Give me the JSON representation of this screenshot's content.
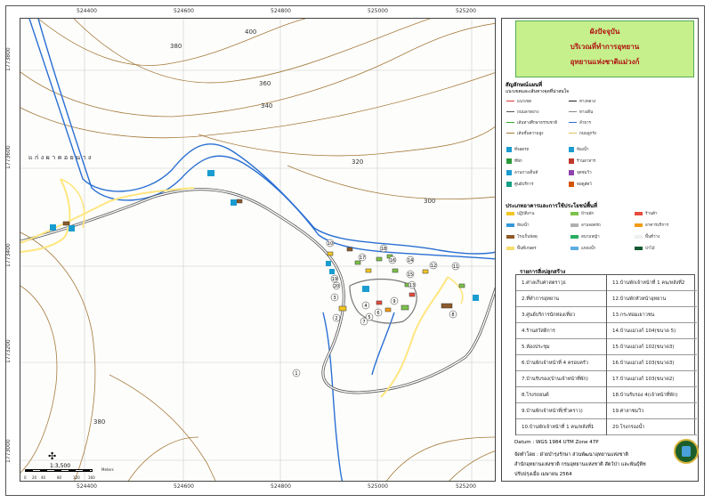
{
  "map": {
    "place_label": "แก่งผาคอยนาง",
    "contours": [
      "400",
      "380",
      "360",
      "340",
      "320",
      "300",
      "380"
    ],
    "x_ticks": [
      "524400",
      "524600",
      "524800",
      "525000",
      "525200"
    ],
    "y_ticks": [
      "1773800",
      "1773600",
      "1773400",
      "1773200",
      "1773000"
    ],
    "building_numbers": [
      "1",
      "2",
      "3",
      "4",
      "5",
      "6",
      "7",
      "8",
      "9",
      "10",
      "11",
      "12",
      "13",
      "14",
      "15",
      "16",
      "17",
      "18",
      "19",
      "20"
    ],
    "scale_text": "1:3,500",
    "scale_unit": "Meters",
    "scale_marks": [
      "0",
      "20",
      "40",
      "80",
      "120",
      "160"
    ],
    "colors": {
      "stream": "#2a6fd4",
      "road": "#ffe680",
      "contour": "#a57a3c",
      "title_bg": "#c6f08c"
    }
  },
  "title": {
    "line1": "ผังปัจจุบัน",
    "line2": "บริเวณที่ทำการอุทยาน",
    "line3": "อุทยานแห่งชาติแม่วงก์"
  },
  "legend": {
    "heading": "สัญลักษณ์แผนที่",
    "sub": "แนวเขตและเส้นทางจุดที่น่าสนใจ",
    "lines": [
      {
        "label": "แนวเขต",
        "color": "#d33"
      },
      {
        "label": "ทางหลวง",
        "color": "#222"
      },
      {
        "label": "ถนนลาดยาง",
        "color": "#555"
      },
      {
        "label": "ทางเดิน",
        "color": "#888"
      },
      {
        "label": "เส้นทางศึกษาธรรมชาติ",
        "color": "#3a3"
      },
      {
        "label": "ลำธาร",
        "color": "#2a6fd4"
      },
      {
        "label": "เส้นชั้นความสูง",
        "color": "#a57a3c"
      },
      {
        "label": "ถนนลูกรัง",
        "color": "#e0c060"
      }
    ],
    "icons": [
      {
        "label": "ที่จอดรถ",
        "color": "#1a9cd0"
      },
      {
        "label": "ห้องน้ำ",
        "color": "#1a9cd0"
      },
      {
        "label": "ที่พัก",
        "color": "#2a9a3a"
      },
      {
        "label": "ร้านอาหาร",
        "color": "#c0392b"
      },
      {
        "label": "ลานกางเต็นท์",
        "color": "#1a9cd0"
      },
      {
        "label": "จุดชมวิว",
        "color": "#8e44ad"
      },
      {
        "label": "ศูนย์บริการ",
        "color": "#16a085"
      },
      {
        "label": "หอดูสัตว์",
        "color": "#d35400"
      }
    ],
    "landuse_heading": "ประเภทอาคารและการใช้ประโยชน์พื้นที่",
    "landuse": [
      {
        "label": "ปฏิบัติงาน",
        "color": "#f3c623"
      },
      {
        "label": "บ้านพัก",
        "color": "#7cc24a"
      },
      {
        "label": "ร้านค้า",
        "color": "#e74c3c"
      },
      {
        "label": "ห้องน้ำ",
        "color": "#3498db"
      },
      {
        "label": "ลานจอดรถ",
        "color": "#b0b0b0"
      },
      {
        "label": "อาคารบริการ",
        "color": "#f39c12"
      },
      {
        "label": "โรงเก็บพัสดุ",
        "color": "#8e5a2a"
      },
      {
        "label": "สนามหญ้า",
        "color": "#27ae60"
      },
      {
        "label": "พื้นที่ว่าง",
        "color": "#ecf0f1"
      },
      {
        "label": "พื้นที่เกษตร",
        "color": "#f7dc6f"
      },
      {
        "label": "แหล่งน้ำ",
        "color": "#5dade2"
      },
      {
        "label": "ป่าไม้",
        "color": "#145a32"
      }
    ]
  },
  "buildings": {
    "heading": "รายการสิ่งปลูกสร้าง",
    "left": [
      "1.ศาลเก็บศาสตราวุธ",
      "2.ที่ทำการอุทยาน",
      "3.ศูนย์บริการนักท่องเที่ยว",
      "4.ร้านสวัสดิการ",
      "5.ห้องประชุม",
      "6.บ้านพักเจ้าหน้าที่ 4 ครอบครัว",
      "7.บ้านรับรอง(บ้านเจ้าหน้าที่พัก)",
      "8.โรงรถยนต์",
      "9.บ้านพักเจ้าหน้าที่(ชั่วคราว)",
      "10.บ้านพักเจ้าหน้าที่ 1 คน/หลังที่1"
    ],
    "right": [
      "11.บ้านพักเจ้าหน้าที่ 1 คน/หลังที่2",
      "12.บ้านพักหัวหน้าอุทยาน",
      "13.กระท่อมเยาวชน",
      "14.บ้านแม่วงก์ 104(ขนาด 5)",
      "15.บ้านแม่วงก์ 102(ขนาด3)",
      "16.บ้านแม่วงก์ 103(ขนาด3)",
      "17.บ้านแม่วงก์ 103(ขนาด2)",
      "18.บ้านรับรอง 4(เจ้าหน้าที่พัก)",
      "19.ศาลาชมวิว",
      "20.โรงกรองน้ำ"
    ]
  },
  "footer": {
    "datum": "Datum  : WGS 1984 UTM Zone 47P",
    "prepared": "จัดทำโดย : ฝ่ายบำรุงรักษา ส่วนพัฒนาอุทยานแห่งชาติ",
    "office": "สำนักอุทยานแห่งชาติ กรมอุทยานแห่งชาติ สัตว์ป่า และพันธุ์พืช",
    "updated": "ปรับปรุงเมื่อ เมษายน 2564"
  }
}
